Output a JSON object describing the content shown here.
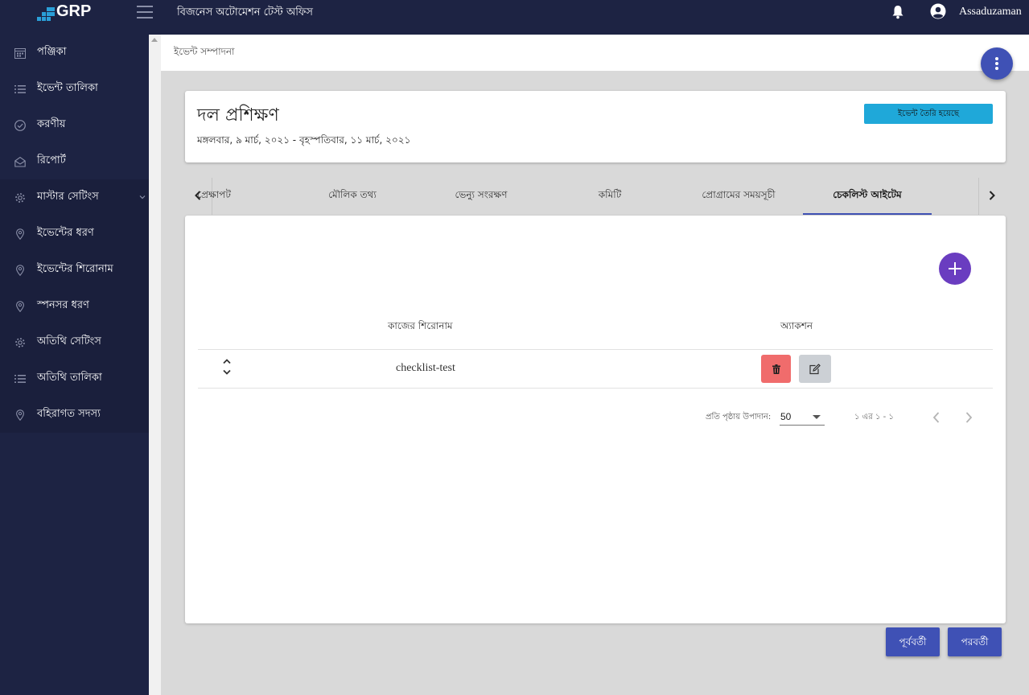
{
  "header": {
    "logo_text": "GRP",
    "app_title": "বিজনেস অটোমেশন টেস্ট অফিস",
    "user_name": "Assaduzaman"
  },
  "sidebar": {
    "items": [
      {
        "label": "পঞ্জিকা",
        "icon": "calendar-icon"
      },
      {
        "label": "ইভেন্ট তালিকা",
        "icon": "list-icon"
      },
      {
        "label": "করণীয়",
        "icon": "check-circle-icon"
      },
      {
        "label": "রিপোর্ট",
        "icon": "mail-open-icon"
      },
      {
        "label": "মাস্টার সেটিংস",
        "icon": "gear-icon",
        "expandable": true
      },
      {
        "label": "ইভেন্টের ধরণ",
        "icon": "location-pin-icon"
      },
      {
        "label": "ইভেন্টের শিরোনাম",
        "icon": "location-pin-icon"
      },
      {
        "label": "স্পনসর ধরণ",
        "icon": "location-pin-icon"
      },
      {
        "label": "অতিথি সেটিংস",
        "icon": "gear-icon"
      },
      {
        "label": "অতিথি তালিকা",
        "icon": "list-icon"
      },
      {
        "label": "বহিরাগত সদস্য",
        "icon": "location-pin-icon"
      }
    ]
  },
  "breadcrumb": "ইভেন্ট সম্পাদনা",
  "event": {
    "title": "দল প্রশিক্ষণ",
    "date_range": "মঙ্গলবার, ৯ মার্চ, ২০২১ - বৃহস্পতিবার, ১১ মার্চ, ২০২১",
    "status": "ইভেন্ট তৈরি হয়েছে"
  },
  "tabs": [
    {
      "label": "প্রেক্ষাপট",
      "active": false
    },
    {
      "label": "মৌলিক তথ্য",
      "active": false
    },
    {
      "label": "ভেন্যু সংরক্ষণ",
      "active": false
    },
    {
      "label": "কমিটি",
      "active": false
    },
    {
      "label": "প্রোগ্রামের সময়সূচী",
      "active": false
    },
    {
      "label": "চেকলিস্ট আইটেম",
      "active": true
    }
  ],
  "table": {
    "columns": [
      "কাজের শিরোনাম",
      "অ্যাকশন"
    ],
    "rows": [
      {
        "title": "checklist-test"
      }
    ]
  },
  "pagination": {
    "per_page_label": "প্রতি পৃষ্ঠায় উপাদান:",
    "per_page_value": "50",
    "range_text": "১ এর ১ - ১"
  },
  "footer_buttons": {
    "previous": "পূর্ববর্তী",
    "next": "পরবর্তী"
  },
  "colors": {
    "sidebar_bg": "#1d2343",
    "primary": "#3f51b5",
    "status_badge": "#1fa8d9",
    "add_button": "#6a3dc0",
    "delete_button": "#f06c6c",
    "edit_button": "#ccd0d5"
  }
}
